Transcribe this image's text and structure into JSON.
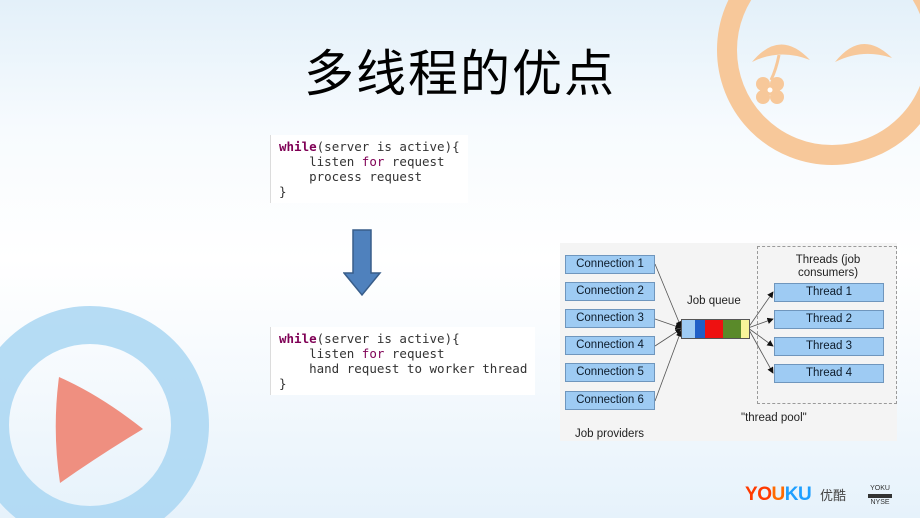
{
  "slide": {
    "title": "多线程的优点",
    "code_before": {
      "lines": [
        {
          "kw": "while",
          "rest": "(server is active){"
        },
        {
          "indent": "    ",
          "pre": "listen ",
          "kw": "for",
          "rest": " request"
        },
        {
          "indent": "    ",
          "text": "process request"
        },
        {
          "text": "}"
        }
      ]
    },
    "code_after": {
      "lines": [
        {
          "kw": "while",
          "rest": "(server is active){"
        },
        {
          "indent": "    ",
          "pre": "listen ",
          "kw": "for",
          "rest": " request"
        },
        {
          "indent": "    ",
          "text": "hand request to worker thread"
        },
        {
          "text": "}"
        }
      ]
    },
    "arrow_icon": "down-arrow-icon",
    "diagram": {
      "connections": [
        "Connection 1",
        "Connection 2",
        "Connection 3",
        "Connection 4",
        "Connection 5",
        "Connection 6"
      ],
      "job_providers_label": "Job providers",
      "job_queue_label": "Job queue",
      "queue_colors": [
        "#9ecbf3",
        "#1f5fc7",
        "#ee1111",
        "#5a8a2a",
        "#f8f59a"
      ],
      "threads_header": "Threads (job consumers)",
      "threads_header_line1": "Threads (job",
      "threads_header_line2": "consumers)",
      "threads": [
        "Thread 1",
        "Thread 2",
        "Thread 3",
        "Thread 4"
      ],
      "thread_pool_label": "\"thread pool\""
    },
    "decor": {
      "smiley_color": "#f7c89a",
      "ring_color": "#a9d6f2",
      "play_color": "#ef8f80"
    },
    "watermark": {
      "youku_letters": [
        "Y",
        "O",
        "U",
        "K",
        "U"
      ],
      "youku_colors": [
        "#ff3a00",
        "#ff3a00",
        "#ff6a00",
        "#1e9fff",
        "#1e9fff"
      ],
      "youku_cn": "优酷",
      "nyse_top": "YOKU",
      "nyse_bottom": "NYSE"
    }
  }
}
